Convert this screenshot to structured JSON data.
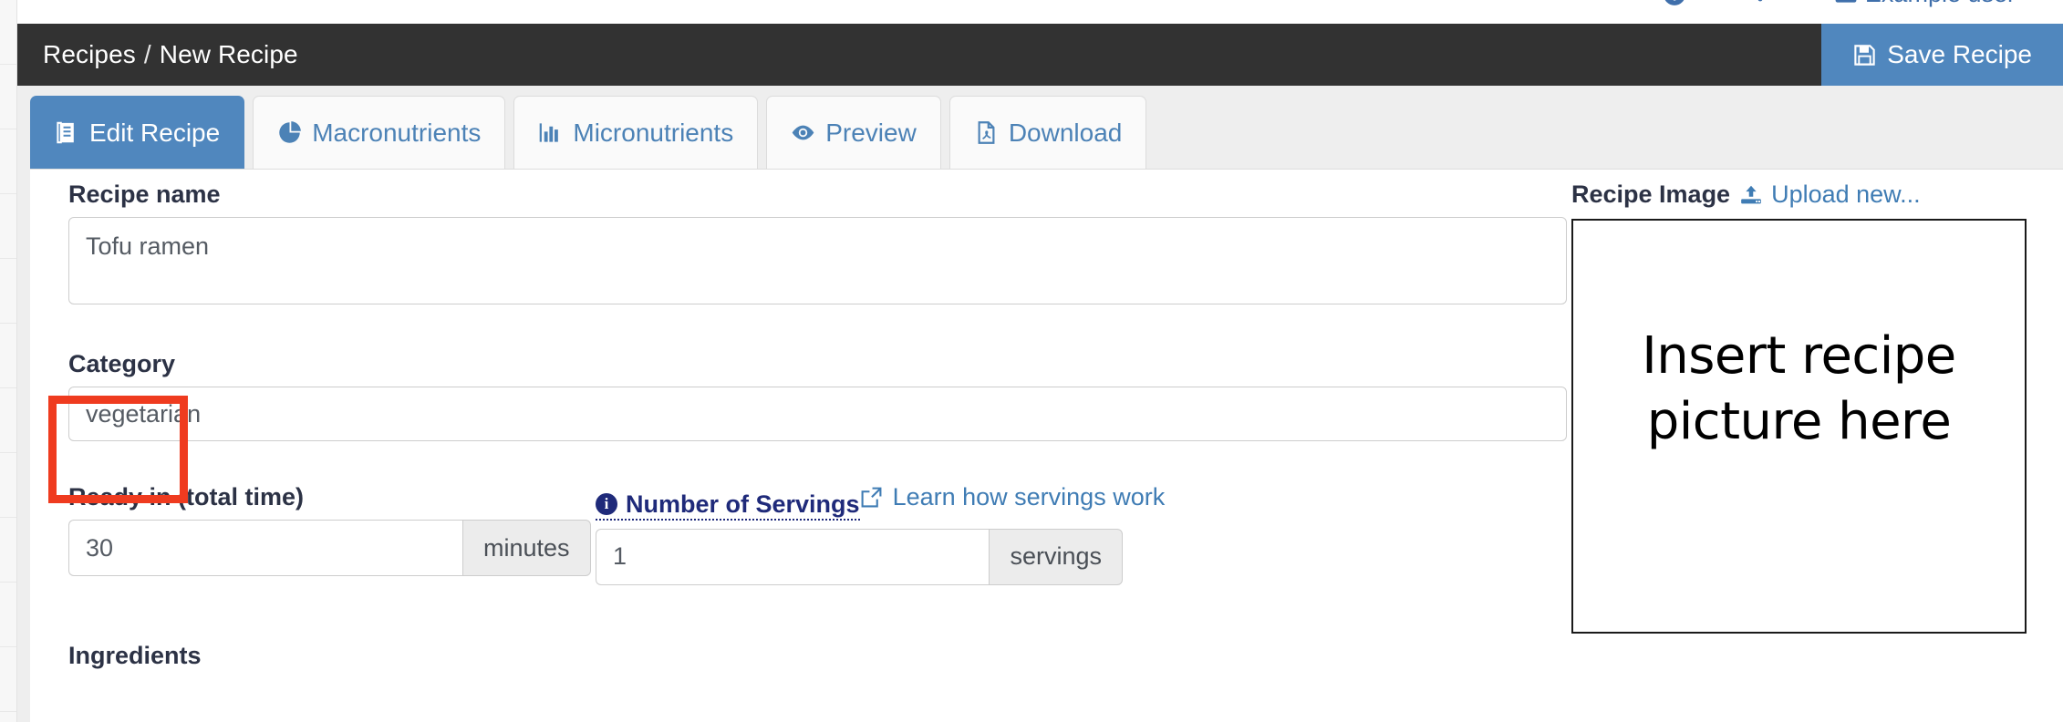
{
  "topbar": {
    "items": [
      {
        "icon": "info-circle-icon",
        "label": ""
      },
      {
        "icon": "bell-icon",
        "label": ""
      },
      {
        "icon": "user-id-icon",
        "label": "Example user"
      }
    ]
  },
  "header": {
    "breadcrumb_root": "Recipes",
    "breadcrumb_separator": "/",
    "breadcrumb_current": "New Recipe",
    "save_label": "Save Recipe",
    "save_icon": "floppy-disk-icon",
    "bar_color": "#323232",
    "accent_color": "#5087be"
  },
  "tabs": [
    {
      "label": "Edit Recipe",
      "icon": "notebook-icon",
      "active": true
    },
    {
      "label": "Macronutrients",
      "icon": "pie-chart-icon",
      "active": false
    },
    {
      "label": "Micronutrients",
      "icon": "bar-chart-icon",
      "active": false
    },
    {
      "label": "Preview",
      "icon": "eye-icon",
      "active": false
    },
    {
      "label": "Download",
      "icon": "pdf-file-icon",
      "active": false
    }
  ],
  "form": {
    "recipe_name": {
      "label": "Recipe name",
      "value": "Tofu ramen"
    },
    "category": {
      "label": "Category",
      "value": "vegetarian",
      "highlight_color": "#ef3b1f"
    },
    "ready_in": {
      "label": "Ready in (total time)",
      "value": "30",
      "unit": "minutes"
    },
    "servings": {
      "label": "Number of Servings",
      "label_icon": "info-circle-icon",
      "value": "1",
      "unit": "servings",
      "help_link": "Learn how servings work",
      "help_link_icon": "external-link-icon"
    },
    "ingredients": {
      "label": "Ingredients"
    }
  },
  "image_panel": {
    "title": "Recipe Image",
    "upload_label": "Upload new...",
    "upload_icon": "upload-icon",
    "placeholder_line1": "Insert recipe",
    "placeholder_line2": "picture here"
  }
}
